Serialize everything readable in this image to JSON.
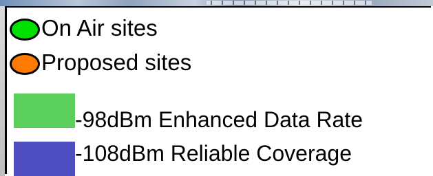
{
  "map": {
    "background": "map-imagery"
  },
  "legend": {
    "sites": [
      {
        "label": "On Air sites",
        "color": "#00e000",
        "icon": "circle-marker-icon"
      },
      {
        "label": "Proposed sites",
        "color": "#ff7a00",
        "icon": "circle-marker-icon"
      }
    ],
    "coverage": [
      {
        "label": "-98dBm Enhanced Data Rate",
        "color": "#5bcf5b"
      },
      {
        "label": "-108dBm Reliable Coverage",
        "color": "#4d4dbf"
      }
    ]
  }
}
